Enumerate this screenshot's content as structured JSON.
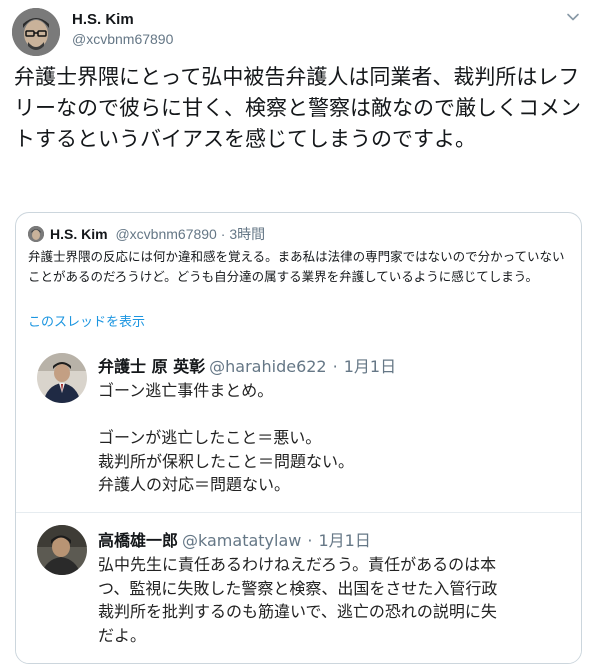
{
  "tweet": {
    "author_name": "H.S. Kim",
    "author_handle": "@xcvbnm67890",
    "avatar_icon": "user-avatar-photo",
    "menu_icon": "chevron-down-icon",
    "text": "弁護士界隈にとって弘中被告弁護人は同業者、裁判所はレフリーなので彼らに甘く、検察と警察は敵なので厳しくコメントするというバイアスを感じてしまうのですよ。"
  },
  "quoted": {
    "author_name": "H.S. Kim",
    "author_handle": "@xcvbnm67890",
    "separator": "·",
    "time": "3時間",
    "text": "弁護士界隈の反応には何か違和感を覚える。まあ私は法律の専門家ではないので分かっていないことがあるのだろうけど。どうも自分達の属する業界を弁護しているように感じてしまう。",
    "thread_link": "このスレッドを表示",
    "link_color": "#1b95e0",
    "screenshot": {
      "posts": [
        {
          "author_name": "弁護士 原 英彰",
          "author_handle": "@harahide622",
          "separator": "·",
          "time": "1月1日",
          "lines": [
            "ゴーン逃亡事件まとめ。",
            "",
            "ゴーンが逃亡したこと＝悪い。",
            "裁判所が保釈したこと＝問題ない。",
            "弁護人の対応＝問題ない。"
          ]
        },
        {
          "author_name": "高橋雄一郎",
          "author_handle": "@kamatatylaw",
          "separator": "·",
          "time": "1月1日",
          "lines": [
            "弘中先生に責任あるわけねえだろう。責任があるのは本",
            "つ、監視に失敗した警察と検察、出国をさせた入管行政",
            "裁判所を批判するのも筋違いで、逃亡の恐れの説明に失",
            "だよ。"
          ]
        }
      ]
    }
  }
}
